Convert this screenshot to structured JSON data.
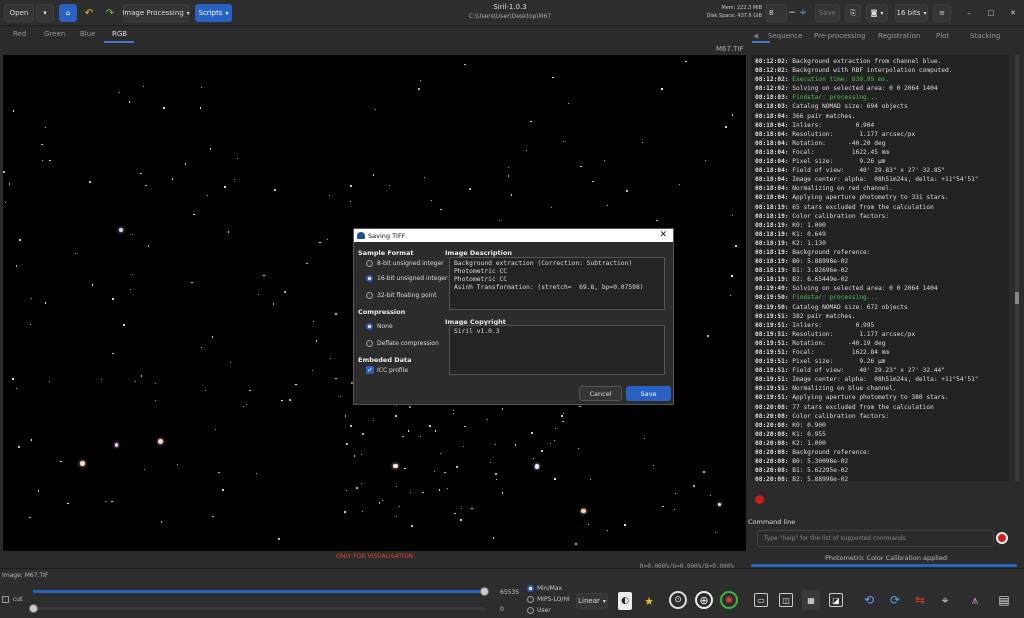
{
  "toolbar": {
    "open_label": "Open",
    "image_processing_label": "Image Processing",
    "scripts_label": "Scripts",
    "save_label": "Save",
    "bits_label": "16 bits",
    "zoom_value": "8"
  },
  "window": {
    "title": "Siril-1.0.3",
    "path": "C:\\Users\\User\\Desktop\\M67",
    "mem": "Mem: 222.3 MiB",
    "disk": "Disk Space: 437.6 GiB"
  },
  "channel_tabs": [
    "Red",
    "Green",
    "Blue",
    "RGB"
  ],
  "filename": "M67.TIF",
  "right_tabs": [
    "Sequence",
    "Pre-processing",
    "Registration",
    "Plot",
    "Stacking"
  ],
  "log_lines": [
    {
      "t": "08:12:02:",
      "m": "Background extraction from channel blue."
    },
    {
      "t": "08:12:02:",
      "m": "Background with RBF interpolation computed."
    },
    {
      "t": "08:12:02:",
      "m": "Execution time: 630.95 ms.",
      "green": true
    },
    {
      "t": "08:12:02:",
      "m": "Solving on selected area: 0 0 2064 1404"
    },
    {
      "t": "08:18:03:",
      "m": "Findstar: processing...",
      "green": true
    },
    {
      "t": "08:18:03:",
      "m": "Catalog NOMAD size: 694 objects"
    },
    {
      "t": "08:18:04:",
      "m": "366 pair matches."
    },
    {
      "t": "08:18:04:",
      "m": "Inliers:         0.904"
    },
    {
      "t": "08:18:04:",
      "m": "Resolution:       1.177 arcsec/px"
    },
    {
      "t": "08:18:04:",
      "m": "Rotation:      -40.20 deg"
    },
    {
      "t": "08:18:04:",
      "m": "Focal:          1622.45 mm"
    },
    {
      "t": "08:18:04:",
      "m": "Pixel size:       9.26 µm"
    },
    {
      "t": "08:18:04:",
      "m": "Field of view:    40' 29.83\" x 27' 32.85\""
    },
    {
      "t": "08:18:04:",
      "m": "Image center: alpha:  08h51m24s, delta: +11°54'51\""
    },
    {
      "t": "08:18:04:",
      "m": "Normalizing on red channel."
    },
    {
      "t": "08:18:04:",
      "m": "Applying aperture photometry to 331 stars."
    },
    {
      "t": "08:18:19:",
      "m": "65 stars excluded from the calculation"
    },
    {
      "t": "08:18:19:",
      "m": "Color calibration factors:"
    },
    {
      "t": "08:18:19:",
      "m": "K0: 1.000"
    },
    {
      "t": "08:18:19:",
      "m": "K1: 0.649"
    },
    {
      "t": "08:18:19:",
      "m": "K2: 1.130"
    },
    {
      "t": "08:18:19:",
      "m": "Background reference:"
    },
    {
      "t": "08:18:19:",
      "m": "B0: 5.88998e-02"
    },
    {
      "t": "08:18:19:",
      "m": "B1: 3.82696e-02"
    },
    {
      "t": "08:18:19:",
      "m": "B2: 6.65449e-02"
    },
    {
      "t": "08:19:49:",
      "m": "Solving on selected area: 0 0 2064 1404"
    },
    {
      "t": "08:19:50:",
      "m": "Findstar: processing...",
      "green": true
    },
    {
      "t": "08:19:50:",
      "m": "Catalog NOMAD size: 672 objects"
    },
    {
      "t": "08:19:51:",
      "m": "382 pair matches."
    },
    {
      "t": "08:19:51:",
      "m": "Inliers:         0.995"
    },
    {
      "t": "08:19:51:",
      "m": "Resolution:       1.177 arcsec/px"
    },
    {
      "t": "08:19:51:",
      "m": "Rotation:      -40.19 deg"
    },
    {
      "t": "08:19:51:",
      "m": "Focal:          1622.84 mm"
    },
    {
      "t": "08:19:51:",
      "m": "Pixel size:       9.26 µm"
    },
    {
      "t": "08:19:51:",
      "m": "Field of view:    40' 29.23\" x 27' 32.44\""
    },
    {
      "t": "08:19:51:",
      "m": "Image center: alpha:  08h51m24s, delta: +11°54'51\""
    },
    {
      "t": "08:19:51:",
      "m": "Normalizing on blue channel."
    },
    {
      "t": "08:19:51:",
      "m": "Applying aperture photometry to 380 stars."
    },
    {
      "t": "08:20:08:",
      "m": "77 stars excluded from the calculation"
    },
    {
      "t": "08:20:08:",
      "m": "Color calibration factors:"
    },
    {
      "t": "08:20:08:",
      "m": "K0: 0.900"
    },
    {
      "t": "08:20:08:",
      "m": "K1: 0.955"
    },
    {
      "t": "08:20:08:",
      "m": "K2: 1.000"
    },
    {
      "t": "08:20:08:",
      "m": "Background reference:"
    },
    {
      "t": "08:20:08:",
      "m": "B0: 5.30098e-02"
    },
    {
      "t": "08:20:08:",
      "m": "B1: 5.62295e-02"
    },
    {
      "t": "08:20:08:",
      "m": "B2: 5.88998e-02"
    }
  ],
  "command": {
    "label": "Command line",
    "placeholder": "Type \"help\" for the list of supported commands"
  },
  "status_message": "Photometric Color Calibration applied",
  "visualisation_note": "ONLY FOR VISUALISATION",
  "pixel_values": "R=0.000%/G=0.000%/B=0.000%",
  "bottom": {
    "image_label": "Image: M67.TIF",
    "cut_label": "cut",
    "hi_value": "65535",
    "lo_value": "0",
    "modes": [
      "Min/Max",
      "MIPS-LO/HI",
      "User"
    ],
    "selected_mode": "Min/Max",
    "scale_label": "Linear",
    "hi_slider_fraction": 1.0,
    "lo_slider_fraction": 0.0
  },
  "dialog": {
    "title": "Saving TIFF",
    "sample_format_label": "Sample Format",
    "formats": [
      "8-bit unsigned integer",
      "16-bit unsigned integer",
      "32-bit floating point"
    ],
    "selected_format": "16-bit unsigned integer",
    "compression_label": "Compression",
    "compressions": [
      "None",
      "Deflate compression"
    ],
    "selected_compression": "None",
    "embedded_label": "Embeded Data",
    "icc_label": "ICC profile",
    "icc_checked": true,
    "description_label": "Image Description",
    "description_text": "Background extraction (Correction: Subtraction)\nPhotometric CC\nPhotometric CC\nAsinh Transformation: (stretch=  69.8, bp=0.07598)",
    "copyright_label": "Image Copyright",
    "copyright_text": "Siril v1.0.3",
    "cancel_label": "Cancel",
    "save_label": "Save"
  },
  "colors": {
    "accent": "#2a62c4",
    "error": "#e0423a",
    "ok_log": "#4bc24b"
  }
}
